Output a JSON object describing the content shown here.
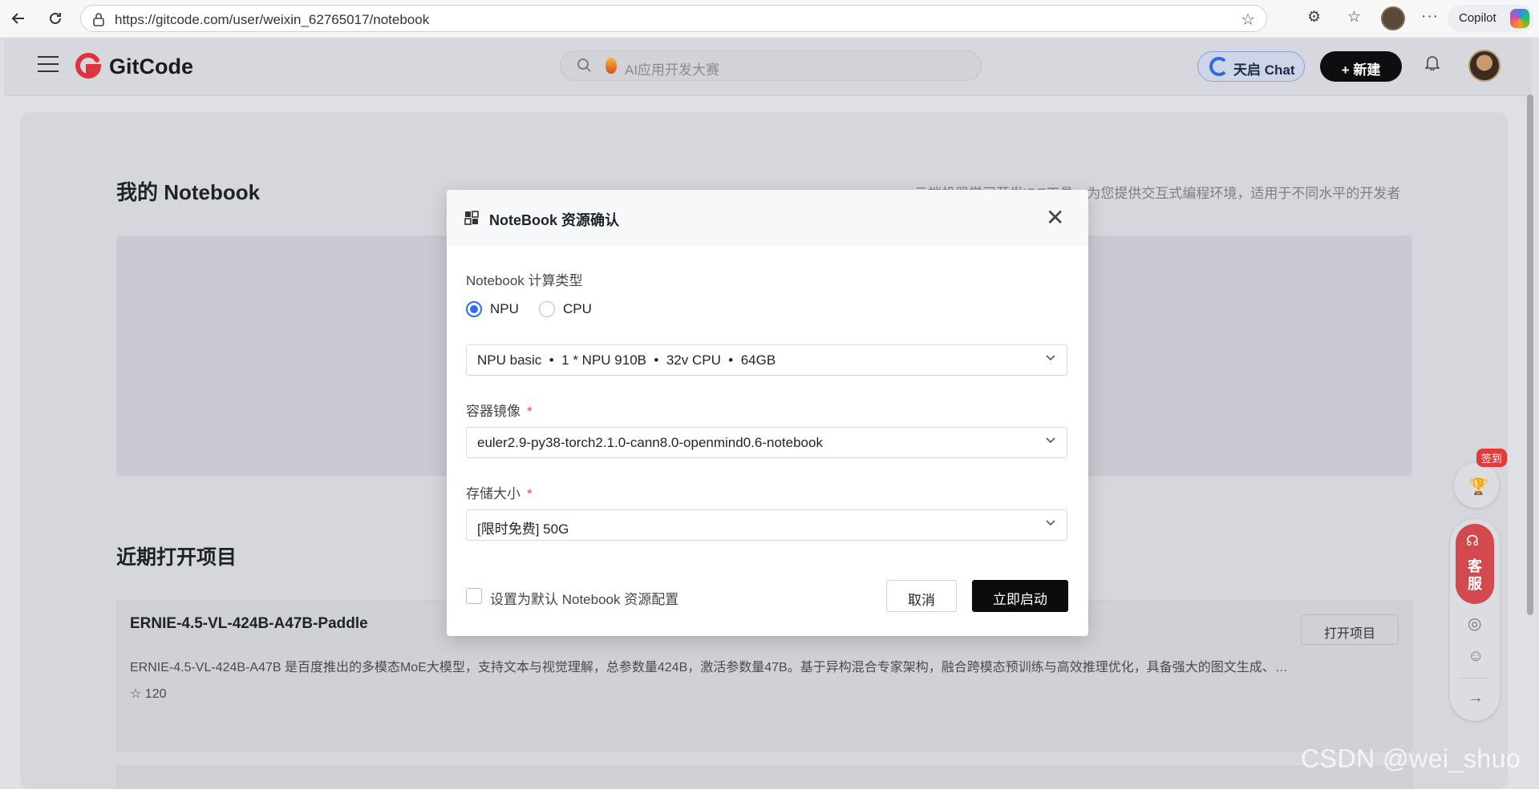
{
  "browser": {
    "url": "https://gitcode.com/user/weixin_62765017/notebook",
    "copilot_label": "Copilot"
  },
  "header": {
    "logo_text": "GitCode",
    "search_placeholder": "AI应用开发大赛",
    "tianqi_label": "天启 Chat",
    "new_label": "+ 新建"
  },
  "page": {
    "title": "我的 Notebook",
    "description": "云端机器学习开发IDE工具，为您提供交互式编程环境，适用于不同水平的开发者",
    "recent_title": "近期打开项目",
    "project": {
      "name": "ERNIE-4.5-VL-424B-A47B-Paddle",
      "description": "ERNIE-4.5-VL-424B-A47B 是百度推出的多模态MoE大模型，支持文本与视觉理解，总参数量424B，激活参数量47B。基于异构混合专家架构，融合跨模态预训练与高效推理优化，具备强大的图文生成、…",
      "stars": "120",
      "open_label": "打开项目"
    }
  },
  "floating": {
    "sign_badge": "签到",
    "kefu_line1": "客",
    "kefu_line2": "服"
  },
  "modal": {
    "title": "NoteBook 资源确认",
    "compute_label": "Notebook 计算类型",
    "radio_npu": "NPU",
    "radio_cpu": "CPU",
    "selected_type": "NPU",
    "spec_value": "NPU basic  •  1 * NPU 910B  •  32v CPU  •  64GB",
    "image_label": "容器镜像",
    "image_value": "euler2.9-py38-torch2.1.0-cann8.0-openmind0.6-notebook",
    "storage_label": "存储大小",
    "storage_value": "[限时免费] 50G",
    "required_mark": "*",
    "default_checkbox_label": "设置为默认 Notebook 资源配置",
    "cancel_label": "取消",
    "start_label": "立即启动"
  },
  "watermark": "CSDN @wei_shuo",
  "colors": {
    "primary": "#2f6bff",
    "dark_button": "#0c0c0e",
    "brand_red": "#e0313c",
    "required": "#e54545"
  }
}
